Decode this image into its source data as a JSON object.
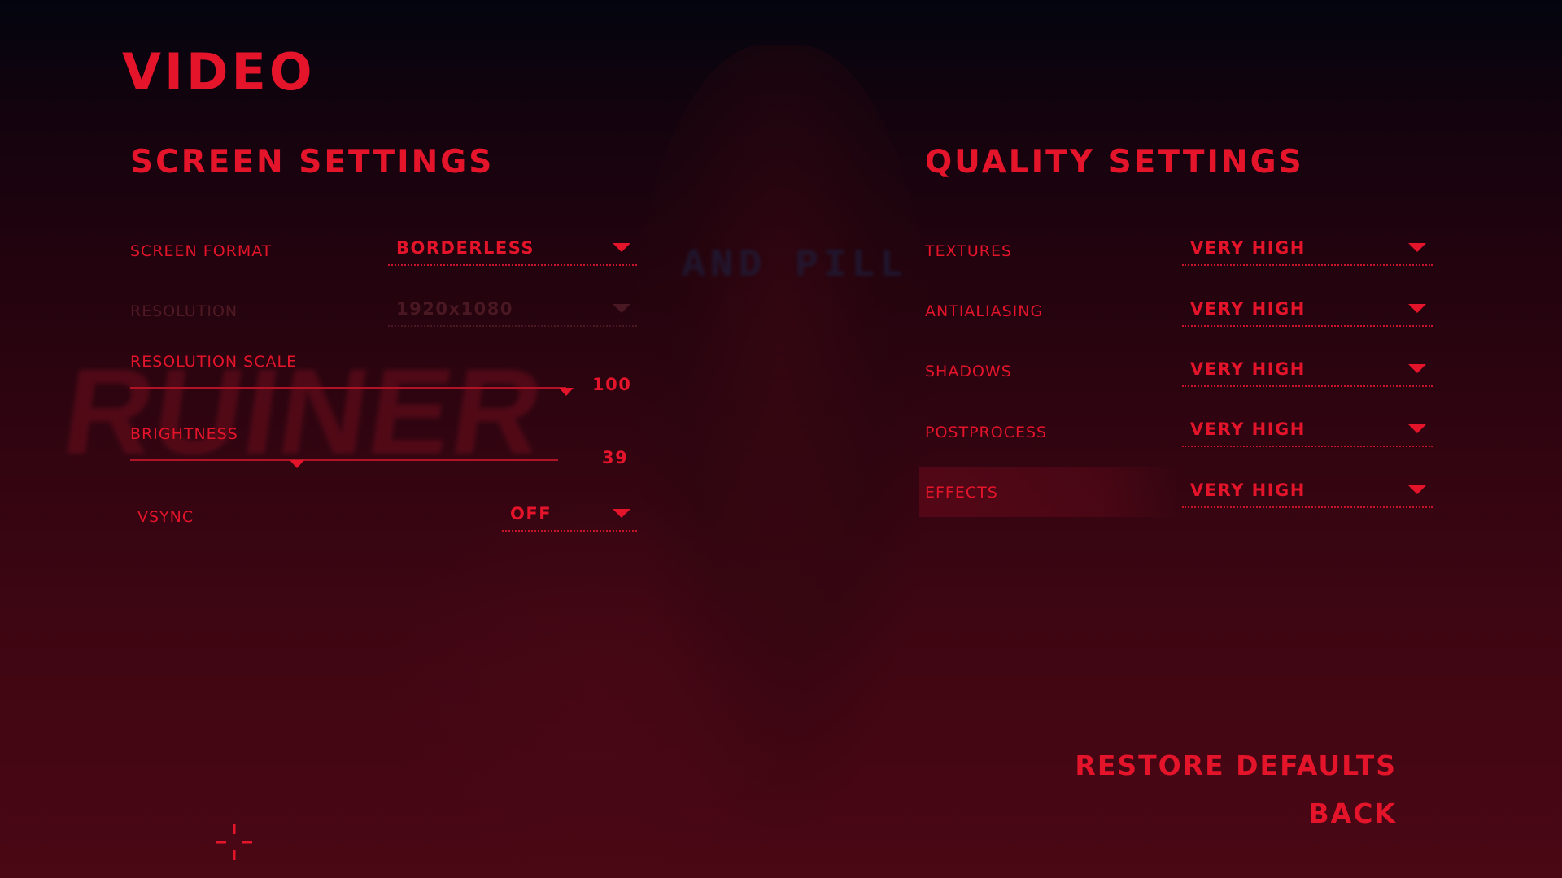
{
  "page": {
    "title": "VIDEO"
  },
  "background": {
    "logo_text": "RUINER",
    "sign_text": "AND PILL"
  },
  "screen_settings": {
    "title": "SCREEN SETTINGS",
    "screen_format": {
      "label": "SCREEN FORMAT",
      "value": "BORDERLESS",
      "enabled": true
    },
    "resolution": {
      "label": "RESOLUTION",
      "value": "1920x1080",
      "enabled": false
    },
    "resolution_scale": {
      "label": "RESOLUTION SCALE",
      "value": "100",
      "level_fraction": 1.0
    },
    "brightness": {
      "label": "BRIGHTNESS",
      "value": "39",
      "level_fraction": 0.39
    },
    "vsync": {
      "label": "VSYNC",
      "value": "OFF",
      "enabled": true
    }
  },
  "quality_settings": {
    "title": "QUALITY SETTINGS",
    "items": [
      {
        "label": "TEXTURES",
        "value": "VERY HIGH"
      },
      {
        "label": "ANTIALIASING",
        "value": "VERY HIGH"
      },
      {
        "label": "SHADOWS",
        "value": "VERY HIGH"
      },
      {
        "label": "POSTPROCESS",
        "value": "VERY HIGH"
      },
      {
        "label": "EFFECTS",
        "value": "VERY HIGH",
        "highlighted": true
      }
    ]
  },
  "actions": {
    "restore_defaults": "RESTORE DEFAULTS",
    "back": "BACK"
  },
  "colors": {
    "accent": "#e4142b",
    "disabled": "#4a1822",
    "background_top": "#03050e",
    "background_bottom": "#4a0714"
  },
  "icons": {
    "dropdown": "triangle-down-icon",
    "cursor": "crosshair-icon"
  }
}
